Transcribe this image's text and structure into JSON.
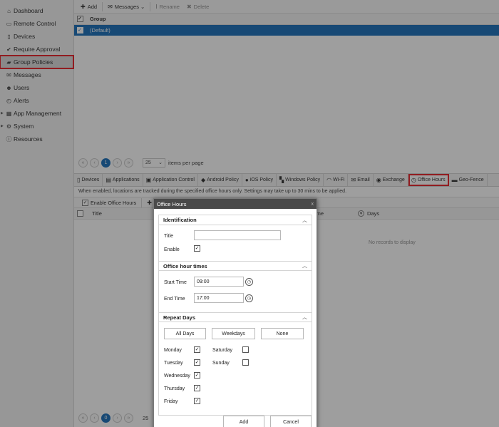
{
  "sidebar": {
    "items": [
      {
        "label": "Dashboard",
        "icon": "home-icon",
        "glyph": "⌂"
      },
      {
        "label": "Remote Control",
        "icon": "monitor-icon",
        "glyph": "▭"
      },
      {
        "label": "Devices",
        "icon": "phone-icon",
        "glyph": "▯"
      },
      {
        "label": "Require Approval",
        "icon": "check-icon",
        "glyph": "✔"
      },
      {
        "label": "Group Policies",
        "icon": "folder-icon",
        "glyph": "▰"
      },
      {
        "label": "Messages",
        "icon": "envelope-icon",
        "glyph": "✉"
      },
      {
        "label": "Users",
        "icon": "users-icon",
        "glyph": "☻"
      },
      {
        "label": "Alerts",
        "icon": "stopwatch-icon",
        "glyph": "◴"
      },
      {
        "label": "App Management",
        "icon": "grid-icon",
        "glyph": "▦"
      },
      {
        "label": "System",
        "icon": "gear-icon",
        "glyph": "⚙"
      },
      {
        "label": "Resources",
        "icon": "info-icon",
        "glyph": "ⓘ"
      }
    ]
  },
  "toolbar": {
    "add": "Add",
    "messages": "Messages",
    "rename": "Rename",
    "delete": "Delete"
  },
  "group_grid": {
    "header": "Group",
    "rows": [
      "(Default)"
    ]
  },
  "pager": {
    "current_page": "1",
    "page_size": "25",
    "items_label": "items per page"
  },
  "tabs": [
    {
      "label": "Devices",
      "icon": "phone-icon",
      "glyph": "▯"
    },
    {
      "label": "Applications",
      "icon": "apps-icon",
      "glyph": "▤"
    },
    {
      "label": "Application Control",
      "icon": "app-control-icon",
      "glyph": "▣"
    },
    {
      "label": "Android Policy",
      "icon": "android-icon",
      "glyph": "◆"
    },
    {
      "label": "iOS Policy",
      "icon": "apple-icon",
      "glyph": "●"
    },
    {
      "label": "Windows Policy",
      "icon": "windows-icon",
      "glyph": "▚"
    },
    {
      "label": "Wi-Fi",
      "icon": "wifi-icon",
      "glyph": "◠"
    },
    {
      "label": "Email",
      "icon": "email-icon",
      "glyph": "✉"
    },
    {
      "label": "Exchange",
      "icon": "exchange-icon",
      "glyph": "◉"
    },
    {
      "label": "Office Hours",
      "icon": "clock-icon",
      "glyph": "◷"
    },
    {
      "label": "Geo-Fence",
      "icon": "geofence-icon",
      "glyph": "▬"
    }
  ],
  "notice": "When enabled, locations are tracked during the specified office hours only. Settings may take up to 30 mins to be applied.",
  "sub_toolbar": {
    "enable": "Enable Office Hours",
    "add_partial": "Ad"
  },
  "sub_grid": {
    "col_title": "Title",
    "col_time": "ime",
    "col_days": "Days",
    "empty": "No records to display"
  },
  "bottom_pager": {
    "current_page": "0",
    "page_size": "25"
  },
  "dialog": {
    "title": "Office Hours",
    "close": "x",
    "identification": {
      "heading": "Identification",
      "title_label": "Title",
      "title_value": "",
      "enable_label": "Enable",
      "enable_checked": true
    },
    "office_hour_times": {
      "heading": "Office hour times",
      "start_label": "Start Time",
      "start_value": "09:00",
      "end_label": "End Time",
      "end_value": "17:00"
    },
    "repeat_days": {
      "heading": "Repeat Days",
      "all_days": "All Days",
      "weekdays": "Weekdays",
      "none": "None",
      "days": [
        {
          "label": "Monday",
          "checked": true
        },
        {
          "label": "Tuesday",
          "checked": true
        },
        {
          "label": "Wednesday",
          "checked": true
        },
        {
          "label": "Thursday",
          "checked": true
        },
        {
          "label": "Friday",
          "checked": true
        },
        {
          "label": "Saturday",
          "checked": false
        },
        {
          "label": "Sunday",
          "checked": false
        }
      ]
    },
    "add_button": "Add",
    "cancel_button": "Cancel"
  },
  "colors": {
    "accent": "#0a64b4",
    "highlight": "#e8131b",
    "dialog_title_bg": "#4a4a4a"
  }
}
